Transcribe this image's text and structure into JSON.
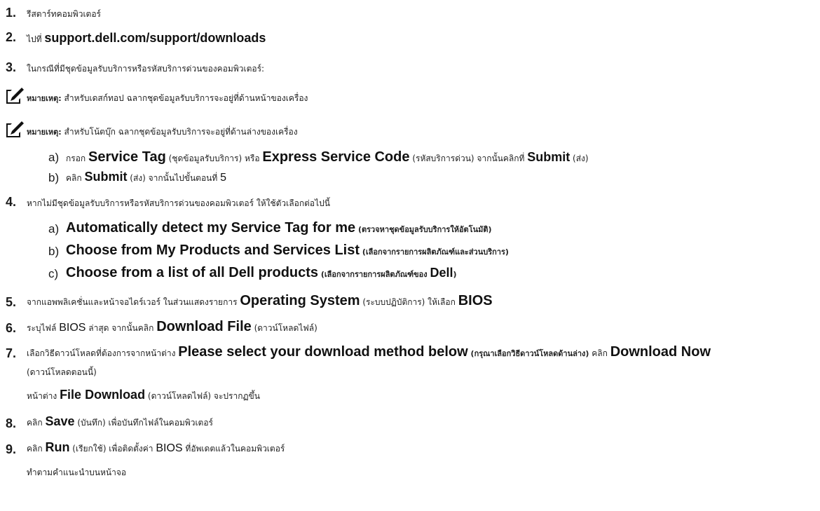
{
  "steps": [
    {
      "num": "1.",
      "text": "รีสตาร์ทคอมพิวเตอร์"
    },
    {
      "num": "2.",
      "pre": "ไปที่ ",
      "link": "support.dell.com/support/downloads"
    },
    {
      "num": "3.",
      "text": "ในกรณีที่มีชุดข้อมูลรับบริการหรือรหัสบริการด่วนของคอมพิวเตอร์:"
    },
    {
      "num": "4.",
      "text": "หากไม่มีชุดข้อมูลรับบริการหรือรหัสบริการด่วนของคอมพิวเตอร์ ให้ใช้ตัวเลือกต่อไปนี้"
    },
    {
      "num": "5.",
      "pre": "จากแอพพลิเคชั่นและหน้าจอไดร์เวอร์ ในส่วนแสดงรายการ ",
      "b1": "Operating System",
      "mid": " (ระบบปฏิบัติการ) ให้เลือก ",
      "b2": "BIOS"
    },
    {
      "num": "6.",
      "pre": "ระบุไฟล์ ",
      "plain": "BIOS",
      "mid": " ล่าสุด จากนั้นคลิก ",
      "b1": "Download File",
      "post": " (ดาวน์โหลดไฟล์)"
    },
    {
      "num": "7.",
      "pre": "เลือกวิธีดาวน์โหลดที่ต้องการจากหน้าต่าง ",
      "b1": "Please select your download method below",
      "b1th": " (กรุณาเลือกวิธีดาวน์โหลดด้านล่าง)",
      "mid": " คลิก ",
      "b2": "Download Now",
      "cont": "(ดาวน์โหลดตอนนี้)",
      "sub_pre": "หน้าต่าง ",
      "sub_b": "File Download",
      "sub_post": " (ดาวน์โหลดไฟล์) จะปรากฏขึ้น"
    },
    {
      "num": "8.",
      "pre": "คลิก ",
      "b1": "Save",
      "post": " (บันทึก) เพื่อบันทึกไฟล์ในคอมพิวเตอร์"
    },
    {
      "num": "9.",
      "pre": "คลิก ",
      "b1": "Run",
      "mid": " (เรียกใช้) เพื่อติดตั้งค่า ",
      "plain": "BIOS",
      "post": " ที่อัพเดตแล้วในคอมพิวเตอร์",
      "follow": "ทำตามคำแนะนำบนหน้าจอ"
    }
  ],
  "notes": [
    {
      "label": "หมายเหตุ:",
      "text": " สำหรับเดสก์ทอป ฉลากชุดข้อมูลรับบริการจะอยู่ที่ด้านหน้าของเครื่อง"
    },
    {
      "label": "หมายเหตุ:",
      "text": " สำหรับโน้ตบุ๊ก ฉลากชุดข้อมูลรับบริการจะอยู่ที่ด้านล่างของเครื่อง"
    }
  ],
  "step3_sub": [
    {
      "letter": "a)",
      "pre": "กรอก ",
      "b1": "Service Tag",
      "m1": " (ชุดข้อมูลรับบริการ) หรือ ",
      "b2": "Express Service Code",
      "m2": " (รหัสบริการด่วน) จากนั้นคลิกที่ ",
      "b3": "Submit",
      "post": " (ส่ง)"
    },
    {
      "letter": "b)",
      "pre": "คลิก ",
      "b1": "Submit",
      "m1": " (ส่ง) จากนั้นไปขั้นตอนที่ ",
      "n": "5"
    }
  ],
  "step4_sub": [
    {
      "letter": "a)",
      "b": "Automatically detect my Service Tag for me",
      "th": " (ตรวจหาชุดข้อมูลรับบริการให้อัตโนมัติ)"
    },
    {
      "letter": "b)",
      "b": "Choose from My Products and Services List",
      "th": " (เลือกจากรายการผลิตภัณฑ์และส่วนบริการ)"
    },
    {
      "letter": "c)",
      "b": "Choose from a list of all Dell products",
      "th": " (เลือกจากรายการผลิตภัณฑ์ของ ",
      "b_end": "Dell",
      "th_end": ")"
    }
  ],
  "icons": {
    "note": "pencil-note-icon"
  }
}
